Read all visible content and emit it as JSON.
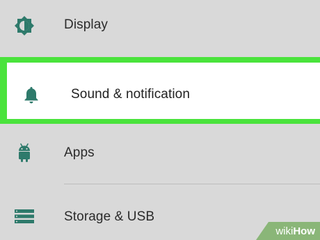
{
  "settings": {
    "items": [
      {
        "label": "Display",
        "icon": "brightness-icon"
      },
      {
        "label": "Sound & notification",
        "icon": "bell-icon",
        "highlighted": true
      },
      {
        "label": "Apps",
        "icon": "android-icon"
      },
      {
        "label": "Storage & USB",
        "icon": "storage-icon"
      }
    ]
  },
  "colors": {
    "background": "#d9d9d9",
    "icon": "#2e7a6b",
    "highlight": "#4ae33c",
    "watermark": "#8ab678"
  },
  "watermark": {
    "prefix": "wiki",
    "suffix": "How"
  }
}
